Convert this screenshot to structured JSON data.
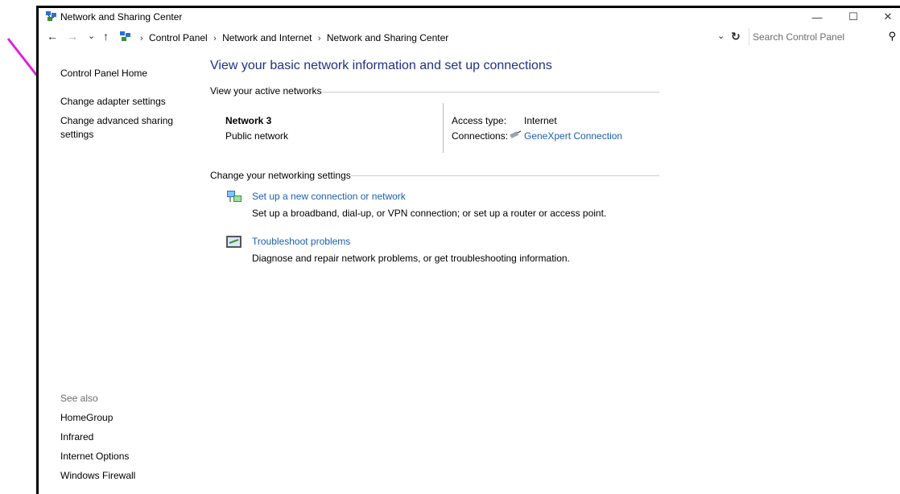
{
  "window": {
    "title": "Network and Sharing Center",
    "controls": {
      "minimize": "—",
      "maximize": "☐",
      "close": "✕"
    }
  },
  "address": {
    "back": "←",
    "forward": "→",
    "recent": "⌄",
    "up": "↑",
    "breadcrumbs": [
      "Control Panel",
      "Network and Internet",
      "Network and Sharing Center"
    ],
    "dropdown": "⌄",
    "refresh": "↻",
    "search_placeholder": "Search Control Panel"
  },
  "sidebar": {
    "home": "Control Panel Home",
    "links": [
      "Change adapter settings",
      "Change advanced sharing settings"
    ],
    "see_also_heading": "See also",
    "see_also": [
      "HomeGroup",
      "Infrared",
      "Internet Options",
      "Windows Firewall"
    ]
  },
  "main": {
    "heading": "View your basic network information and set up connections",
    "active_networks_label": "View your active networks",
    "network": {
      "name": "Network  3",
      "type": "Public network",
      "access_type_label": "Access type:",
      "access_type_value": "Internet",
      "connections_label": "Connections:",
      "connection_name": "GeneXpert Connection"
    },
    "change_settings_label": "Change your networking settings",
    "tasks": [
      {
        "title": "Set up a new connection or network",
        "desc": "Set up a broadband, dial-up, or VPN connection; or set up a router or access point."
      },
      {
        "title": "Troubleshoot problems",
        "desc": "Diagnose and repair network problems, or get troubleshooting information."
      }
    ]
  },
  "annotation": {
    "arrow_color": "#e020e0"
  },
  "colors": {
    "link": "#1a5fb4",
    "heading": "#1e3287"
  }
}
